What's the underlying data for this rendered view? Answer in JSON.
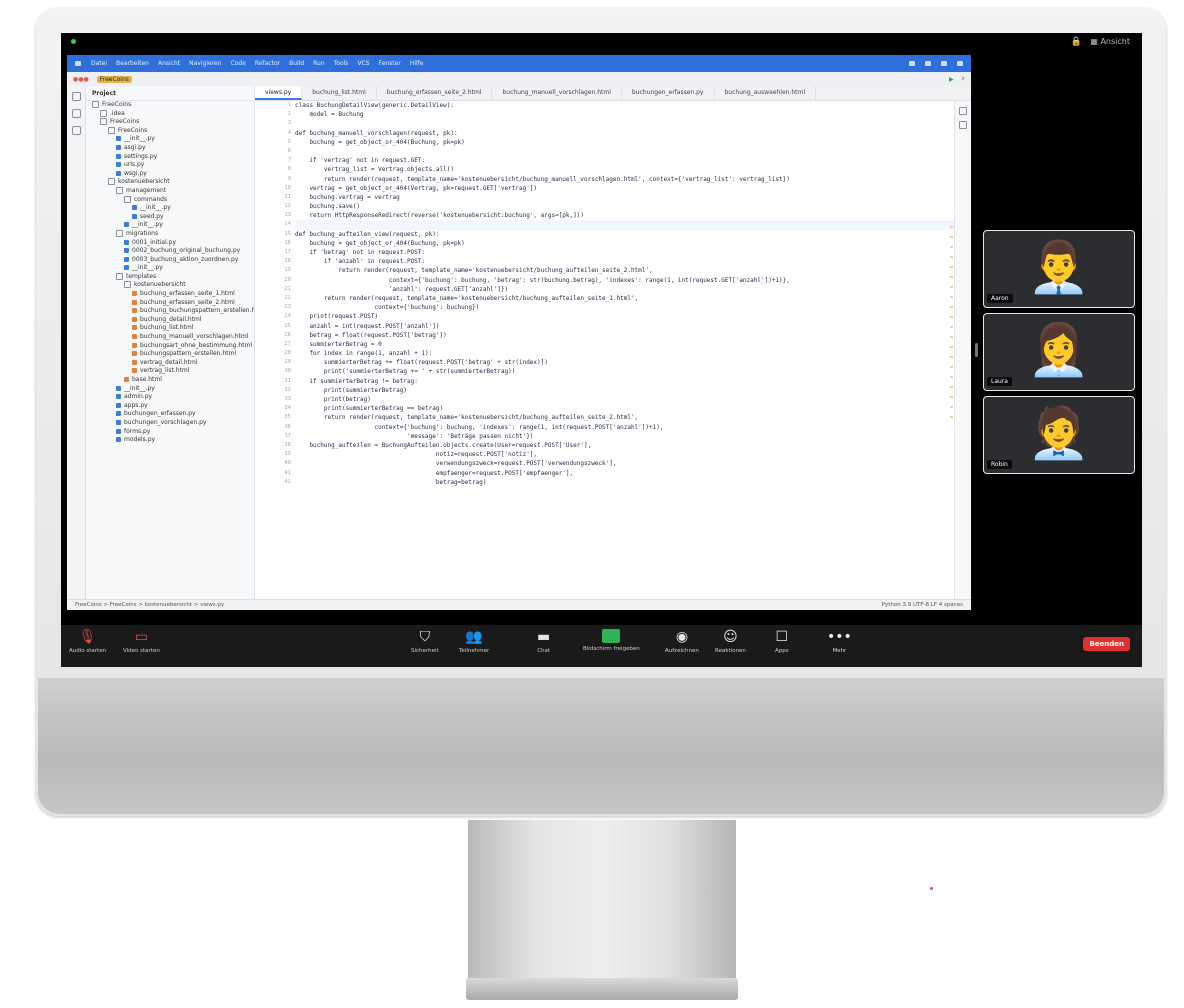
{
  "zoom": {
    "view_label": "Ansicht",
    "participants": [
      {
        "name": "Aaron",
        "avatar": "👨‍💼"
      },
      {
        "name": "Laura",
        "avatar": "👩‍💼"
      },
      {
        "name": "Robin",
        "avatar": "🧑‍💼"
      }
    ],
    "controls": [
      {
        "label": "Audio starten",
        "icon": "microphone-muted-icon"
      },
      {
        "label": "Video starten",
        "icon": "camera-off-icon"
      },
      {
        "label": "Sicherheit",
        "icon": "shield-icon"
      },
      {
        "label": "Teilnehmer",
        "icon": "participants-icon"
      },
      {
        "label": "Chat",
        "icon": "chat-icon"
      },
      {
        "label": "Bildschirm freigeben",
        "icon": "share-screen-icon"
      },
      {
        "label": "Aufzeichnen",
        "icon": "record-icon"
      },
      {
        "label": "Reaktionen",
        "icon": "reactions-icon"
      },
      {
        "label": "Apps",
        "icon": "apps-icon"
      },
      {
        "label": "Mehr",
        "icon": "more-icon"
      }
    ],
    "end_label": "Beenden"
  },
  "ide": {
    "menu": [
      "Datei",
      "Bearbeiten",
      "Ansicht",
      "Navigieren",
      "Code",
      "Refactor",
      "Build",
      "Run",
      "Tools",
      "VCS",
      "Fenster",
      "Hilfe"
    ],
    "project_label": "Project",
    "project_chip": "FreeCoins",
    "tabs": [
      "views.py",
      "buchung_list.html",
      "buchung_erfassen_seite_2.html",
      "buchung_manuell_vorschlagen.html",
      "buchungen_erfassen.py",
      "buchung_auswaehlen.html"
    ],
    "tree": [
      {
        "t": "FreeCoins",
        "k": "folder",
        "d": 0
      },
      {
        "t": ".idea",
        "k": "folder",
        "d": 1
      },
      {
        "t": "FreeCoins",
        "k": "folder",
        "d": 1
      },
      {
        "t": "FreeCoins",
        "k": "folder",
        "d": 2
      },
      {
        "t": "__init__.py",
        "k": "py",
        "d": 3
      },
      {
        "t": "asgi.py",
        "k": "py",
        "d": 3
      },
      {
        "t": "settings.py",
        "k": "py",
        "d": 3
      },
      {
        "t": "urls.py",
        "k": "py",
        "d": 3
      },
      {
        "t": "wsgi.py",
        "k": "py",
        "d": 3
      },
      {
        "t": "kostenuebersicht",
        "k": "folder",
        "d": 2
      },
      {
        "t": "management",
        "k": "folder",
        "d": 3
      },
      {
        "t": "commands",
        "k": "folder",
        "d": 4
      },
      {
        "t": "__init__.py",
        "k": "py",
        "d": 5
      },
      {
        "t": "seed.py",
        "k": "py",
        "d": 5
      },
      {
        "t": "__init__.py",
        "k": "py",
        "d": 4
      },
      {
        "t": "migrations",
        "k": "folder",
        "d": 3
      },
      {
        "t": "0001_initial.py",
        "k": "py",
        "d": 4
      },
      {
        "t": "0002_buchung_original_buchung.py",
        "k": "py",
        "d": 4
      },
      {
        "t": "0003_buchung_aktion_zuordnen.py",
        "k": "py",
        "d": 4
      },
      {
        "t": "__init__.py",
        "k": "py",
        "d": 4
      },
      {
        "t": "templates",
        "k": "folder",
        "d": 3
      },
      {
        "t": "kostenuebersicht",
        "k": "folder",
        "d": 4
      },
      {
        "t": "buchung_erfassen_seite_1.html",
        "k": "html",
        "d": 5
      },
      {
        "t": "buchung_erfassen_seite_2.html",
        "k": "html",
        "d": 5
      },
      {
        "t": "buchung_buchungspattern_erstellen.html",
        "k": "html",
        "d": 5
      },
      {
        "t": "buchung_detail.html",
        "k": "html",
        "d": 5
      },
      {
        "t": "buchung_list.html",
        "k": "html",
        "d": 5
      },
      {
        "t": "buchung_manuell_vorschlagen.html",
        "k": "html",
        "d": 5
      },
      {
        "t": "buchungsart_ohne_bestimmung.html",
        "k": "html",
        "d": 5
      },
      {
        "t": "buchungspattern_erstellen.html",
        "k": "html",
        "d": 5
      },
      {
        "t": "vertrag_detail.html",
        "k": "html",
        "d": 5
      },
      {
        "t": "vertrag_list.html",
        "k": "html",
        "d": 5
      },
      {
        "t": "base.html",
        "k": "html",
        "d": 4
      },
      {
        "t": "__init__.py",
        "k": "py",
        "d": 3
      },
      {
        "t": "admin.py",
        "k": "py",
        "d": 3
      },
      {
        "t": "apps.py",
        "k": "py",
        "d": 3
      },
      {
        "t": "buchungen_erfassen.py",
        "k": "py",
        "d": 3
      },
      {
        "t": "buchungen_vorschlagen.py",
        "k": "py",
        "d": 3
      },
      {
        "t": "forms.py",
        "k": "py",
        "d": 3
      },
      {
        "t": "models.py",
        "k": "py",
        "d": 3
      }
    ],
    "code": [
      "class BuchungDetailView(generic.DetailView):",
      "    model = Buchung",
      "",
      "def buchung_manuell_vorschlagen(request, pk):",
      "    buchung = get_object_or_404(Buchung, pk=pk)",
      "",
      "    if 'vertrag' not in request.GET:",
      "        vertrag_list = Vertrag.objects.all()",
      "        return render(request, template_name='kostenuebersicht/buchung_manuell_vorschlagen.html', context={'vertrag_list': vertrag_list})",
      "    vertrag = get_object_or_404(Vertrag, pk=request.GET['vertrag'])",
      "    buchung.vertrag = vertrag",
      "    buchung.save()",
      "    return HttpResponseRedirect(reverse('kostenuebersicht:buchung', args=[pk,]))",
      "",
      "def buchung_aufteilen_view(request, pk):",
      "    buchung = get_object_or_404(Buchung, pk=pk)",
      "    if 'betrag' not in request.POST:",
      "        if 'anzahl' in request.POST:",
      "            return render(request, template_name='kostenuebersicht/buchung_aufteilen_seite_2.html',",
      "                          context={'buchung': buchung, 'betrag': str(buchung.betrag), 'indexes': range(1, int(request.GET['anzahl'])+1)},",
      "                          'anzahl': request.GET['anzahl']})",
      "        return render(request, template_name='kostenuebersicht/buchung_aufteilen_seite_1.html',",
      "                      context={'buchung': buchung})",
      "    print(request.POST)",
      "    anzahl = int(request.POST['anzahl'])",
      "    betrag = float(request.POST['betrag'])",
      "    summierterBetrag = 0",
      "    for index in range(1, anzahl + 1):",
      "        summierterBetrag += float(request.POST['betrag' + str(index)])",
      "        print('summierterBetrag += ' + str(summierterBetrag))",
      "    if summierterBetrag != betrag:",
      "        print(summierterBetrag)",
      "        print(betrag)",
      "        print(summierterBetrag == betrag)",
      "        return render(request, template_name='kostenuebersicht/buchung_aufteilen_seite_2.html',",
      "                      context={'buchung': buchung, 'indexes': range(1, int(request.POST['anzahl'])+1),",
      "                               'message': 'Beträge passen nicht'})",
      "    buchung_aufteilen = BuchungAufteilen.objects.create(User=request.POST['User'],",
      "                                       notiz=request.POST['notiz'],",
      "                                       verwendungszweck=request.POST['verwendungszweck'],",
      "                                       empfaenger=request.POST['empfaenger'],",
      "                                       betrag=betrag)"
    ],
    "start_line": 1,
    "current_line": 14,
    "status_left": "FreeCoins > FreeCoins > kostenuebersicht > views.py",
    "status_right": "Python 3.9   UTF-8   LF   4 spaces"
  }
}
